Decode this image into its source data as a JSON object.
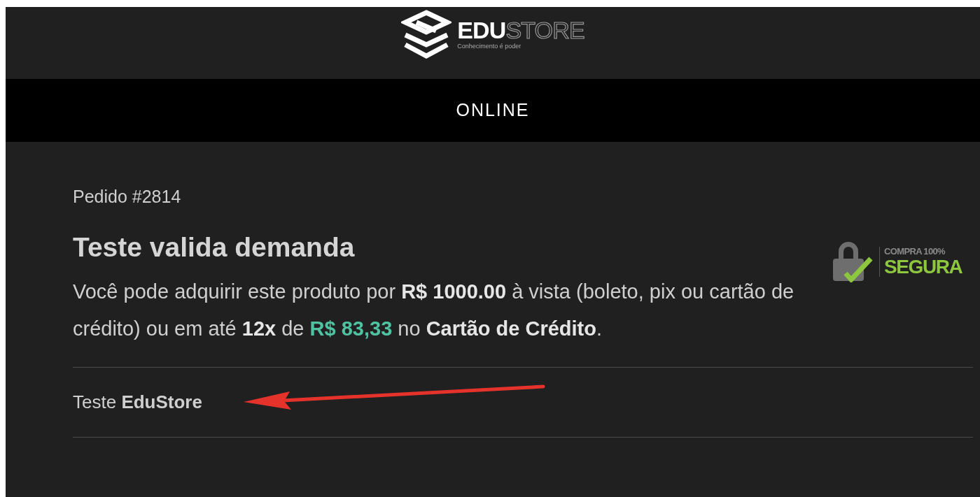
{
  "logo": {
    "word_solid": "EDU",
    "word_outline": "STORE",
    "tagline": "Conhecimento é poder"
  },
  "nav": {
    "label": "ONLINE"
  },
  "order": {
    "number": "Pedido #2814",
    "title": "Teste valida demanda",
    "description": [
      {
        "kind": "plain",
        "text": "Você pode adquirir este produto por "
      },
      {
        "kind": "bold",
        "text": "R$ 1000.00"
      },
      {
        "kind": "plain",
        "text": " à vista (boleto, pix ou cartão de crédito) ou em até "
      },
      {
        "kind": "bold",
        "text": "12x"
      },
      {
        "kind": "plain",
        "text": " de "
      },
      {
        "kind": "price",
        "text": "R$ 83,33"
      },
      {
        "kind": "plain",
        "text": " no "
      },
      {
        "kind": "bold",
        "text": "Cartão de Crédito"
      },
      {
        "kind": "plain",
        "text": "."
      }
    ],
    "seller": "Teste **EduStore**"
  },
  "badge": {
    "line1": "COMPRA 100%",
    "line2": "SEGURA"
  }
}
